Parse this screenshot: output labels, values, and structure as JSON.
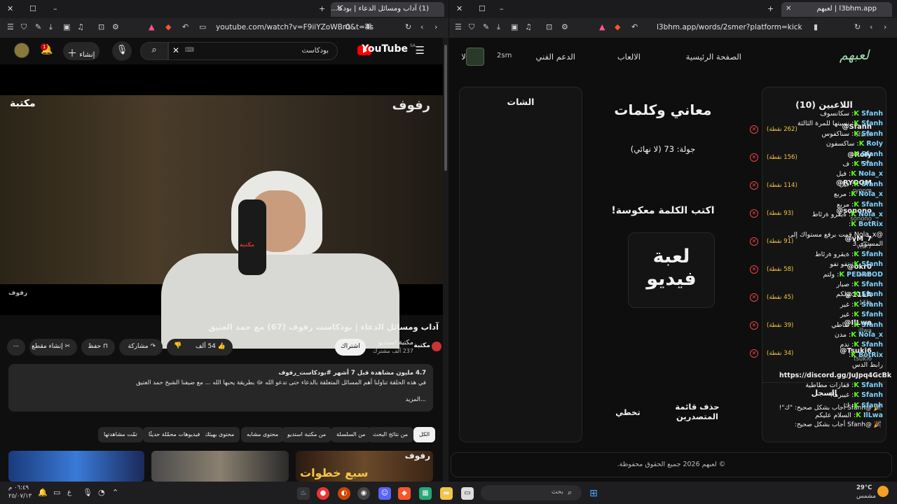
{
  "left_window": {
    "tab_title": "(1) آداب ومسائل الدعاء | بودكا...",
    "url": "youtube.com/watch?v=F9iiYZoWBr0&t=4s",
    "youtube": {
      "logo": "YouTube",
      "logo_region": "SA",
      "search_value": "بودكاست",
      "create_label": "إنشاء",
      "notif_count": "1",
      "video_watermark": "رفوف",
      "video_corner": "رفوف",
      "channel_badge": "مكتبة",
      "mic_text": "مكتبة",
      "title": "آداب ومسائل الدعاء | بودكاست رفوف (67) مع حمد العتيق",
      "channel_name": "مكتبة استديو",
      "subscribers": "237 ألف مشترك",
      "subscribe": "اشتراك",
      "like_count": "54 ألف",
      "share": "مشاركة",
      "save": "حفظ",
      "clip": "إنشاء مقطع",
      "more": "...",
      "desc_meta": "4.7 مليون مشاهدة  قبل 7 أشهر  #بودكاست_رفوف",
      "desc_text": "في هذه الحلقة تناولنا أهم المسائل المتعلقة بالدعاء حتى تدعو الله ﷻ بطريقة يحبها الله ... مع ضيفنا الشيخ حمد العتيق",
      "desc_more": "...المزيد",
      "chips": [
        "الكل",
        "من نتائج البحث",
        "من السلسلة",
        "من مكتبة استديو",
        "محتوى مشابه",
        "محتوى بهيئك",
        "فيديوهات محمّلة حديثًا",
        "تمّت مشاهدتها"
      ],
      "thumb_text": "سبع خطوات",
      "thumb_brand": "رفوف"
    }
  },
  "right_window": {
    "tab_title": "l3bhm.app | لعبهم",
    "url": "l3bhm.app/words/2smer?platform=kick",
    "site": {
      "logo": "لعبهم",
      "nav": [
        "الصفحة الرئيسية",
        "الالعاب",
        "الدعم الفني",
        "الا"
      ],
      "user_tag": "2sm",
      "players_header": "اللاعبين (10)",
      "players": [
        {
          "name": "@Sfanh",
          "user": "sfanh",
          "score": "(262 نقطة)"
        },
        {
          "name": "@RoIy",
          "user": "roly",
          "score": "(156 نقطة)"
        },
        {
          "name": "@RYOOM",
          "user": "ryoom",
          "score": "(114 نقطة)"
        },
        {
          "name": "@sonono",
          "user": "sonono",
          "score": "(93 نقطة)"
        },
        {
          "name": "@vM_7",
          "user": "vm-7",
          "score": "(91 نقطة)"
        },
        {
          "name": "@okr0",
          "user": "okr0",
          "score": "(58 نقطة)"
        },
        {
          "name": "@11LA",
          "user": "11la",
          "score": "(45 نقطة)"
        },
        {
          "name": "@IlLwa",
          "user": "illwa",
          "score": "(39 نقطة)"
        },
        {
          "name": "@Tsuki6",
          "user": "tsuki6",
          "score": "(34 نقطة)"
        }
      ],
      "log_header": "السجل",
      "log": [
        "@Sfanh أجاب بشكل صحيح: \"ك\"!",
        "@Sfanh أجاب بشكل صحيح:"
      ],
      "game_title": "معاني وكلمات",
      "round": "جولة: 73 (لا نهائي)",
      "instruction": "اكتب الكلمة معكوسة!",
      "word": "لعبة فيديو",
      "clear_label": "حذف قائمة المتصدرين",
      "skip_label": "تخطي",
      "chat_header": "الشات",
      "chat": [
        {
          "user": "Sfanh",
          "msg": "سكانسوف"
        },
        {
          "user": "Sfanh",
          "msg": "نسيتها للمرة الثالثة"
        },
        {
          "user": "Sfanh",
          "msg": "سناكفوس"
        },
        {
          "user": "RoIy",
          "msg": "ساكسفون"
        },
        {
          "user": "Sfanh",
          "msg": ""
        },
        {
          "user": "Sfanh",
          "msg": "ف"
        },
        {
          "user": "Nola_x",
          "msg": "فيل"
        },
        {
          "user": "Sfanh",
          "msg": "فيل"
        },
        {
          "user": "Nola_x",
          "msg": "مربع"
        },
        {
          "user": "Sfanh",
          "msg": "مربع"
        },
        {
          "user": "Nola_x",
          "msg": "ةيقرو ةرئاط"
        },
        {
          "user": "BotRix",
          "msg": ""
        },
        {
          "user": "",
          "msg": "@Nola_x قمت برفع مستواك إلى المستوى 3"
        },
        {
          "user": "Sfanh",
          "msg": "ةيقرو ةرئاط"
        },
        {
          "user": "Sfanh",
          "msg": "تفو تفو"
        },
        {
          "user": "PEDRBOD",
          "msg": "ولتم"
        },
        {
          "user": "Sfanh",
          "msg": "صبار"
        },
        {
          "user": "Sfanh",
          "msg": "ولكم"
        },
        {
          "user": "Sfanh",
          "msg": "غير"
        },
        {
          "user": "Sfanh",
          "msg": "غير"
        },
        {
          "user": "Sfanh",
          "msg": "نقاطي"
        },
        {
          "user": "Nola_x",
          "msg": "مدن"
        },
        {
          "user": "Sfanh",
          "msg": "ندم"
        },
        {
          "user": "BotRix",
          "msg": ""
        },
        {
          "user": "",
          "msg": "رابط الدس"
        },
        {
          "user": "",
          "msg": "https://discord.gg/JuJpq4GcBk"
        },
        {
          "user": "Sfanh",
          "msg": "قفازات مطاطية"
        },
        {
          "user": "Sfanh",
          "msg": "غيبرها!"
        },
        {
          "user": "Sfanh",
          "msg": "ك"
        },
        {
          "user": "IlLwa",
          "msg": "السلام عليكم"
        }
      ],
      "footer": "© لعبهم 2026 جميع الحقوق محفوظة."
    }
  },
  "taskbar": {
    "time": "٠٦:٤٩ م",
    "date": "٢٥/٠٧/١٣",
    "lang": "ع",
    "search_placeholder": "بحث",
    "weather_temp": "29°C",
    "weather_desc": "مشمس"
  }
}
